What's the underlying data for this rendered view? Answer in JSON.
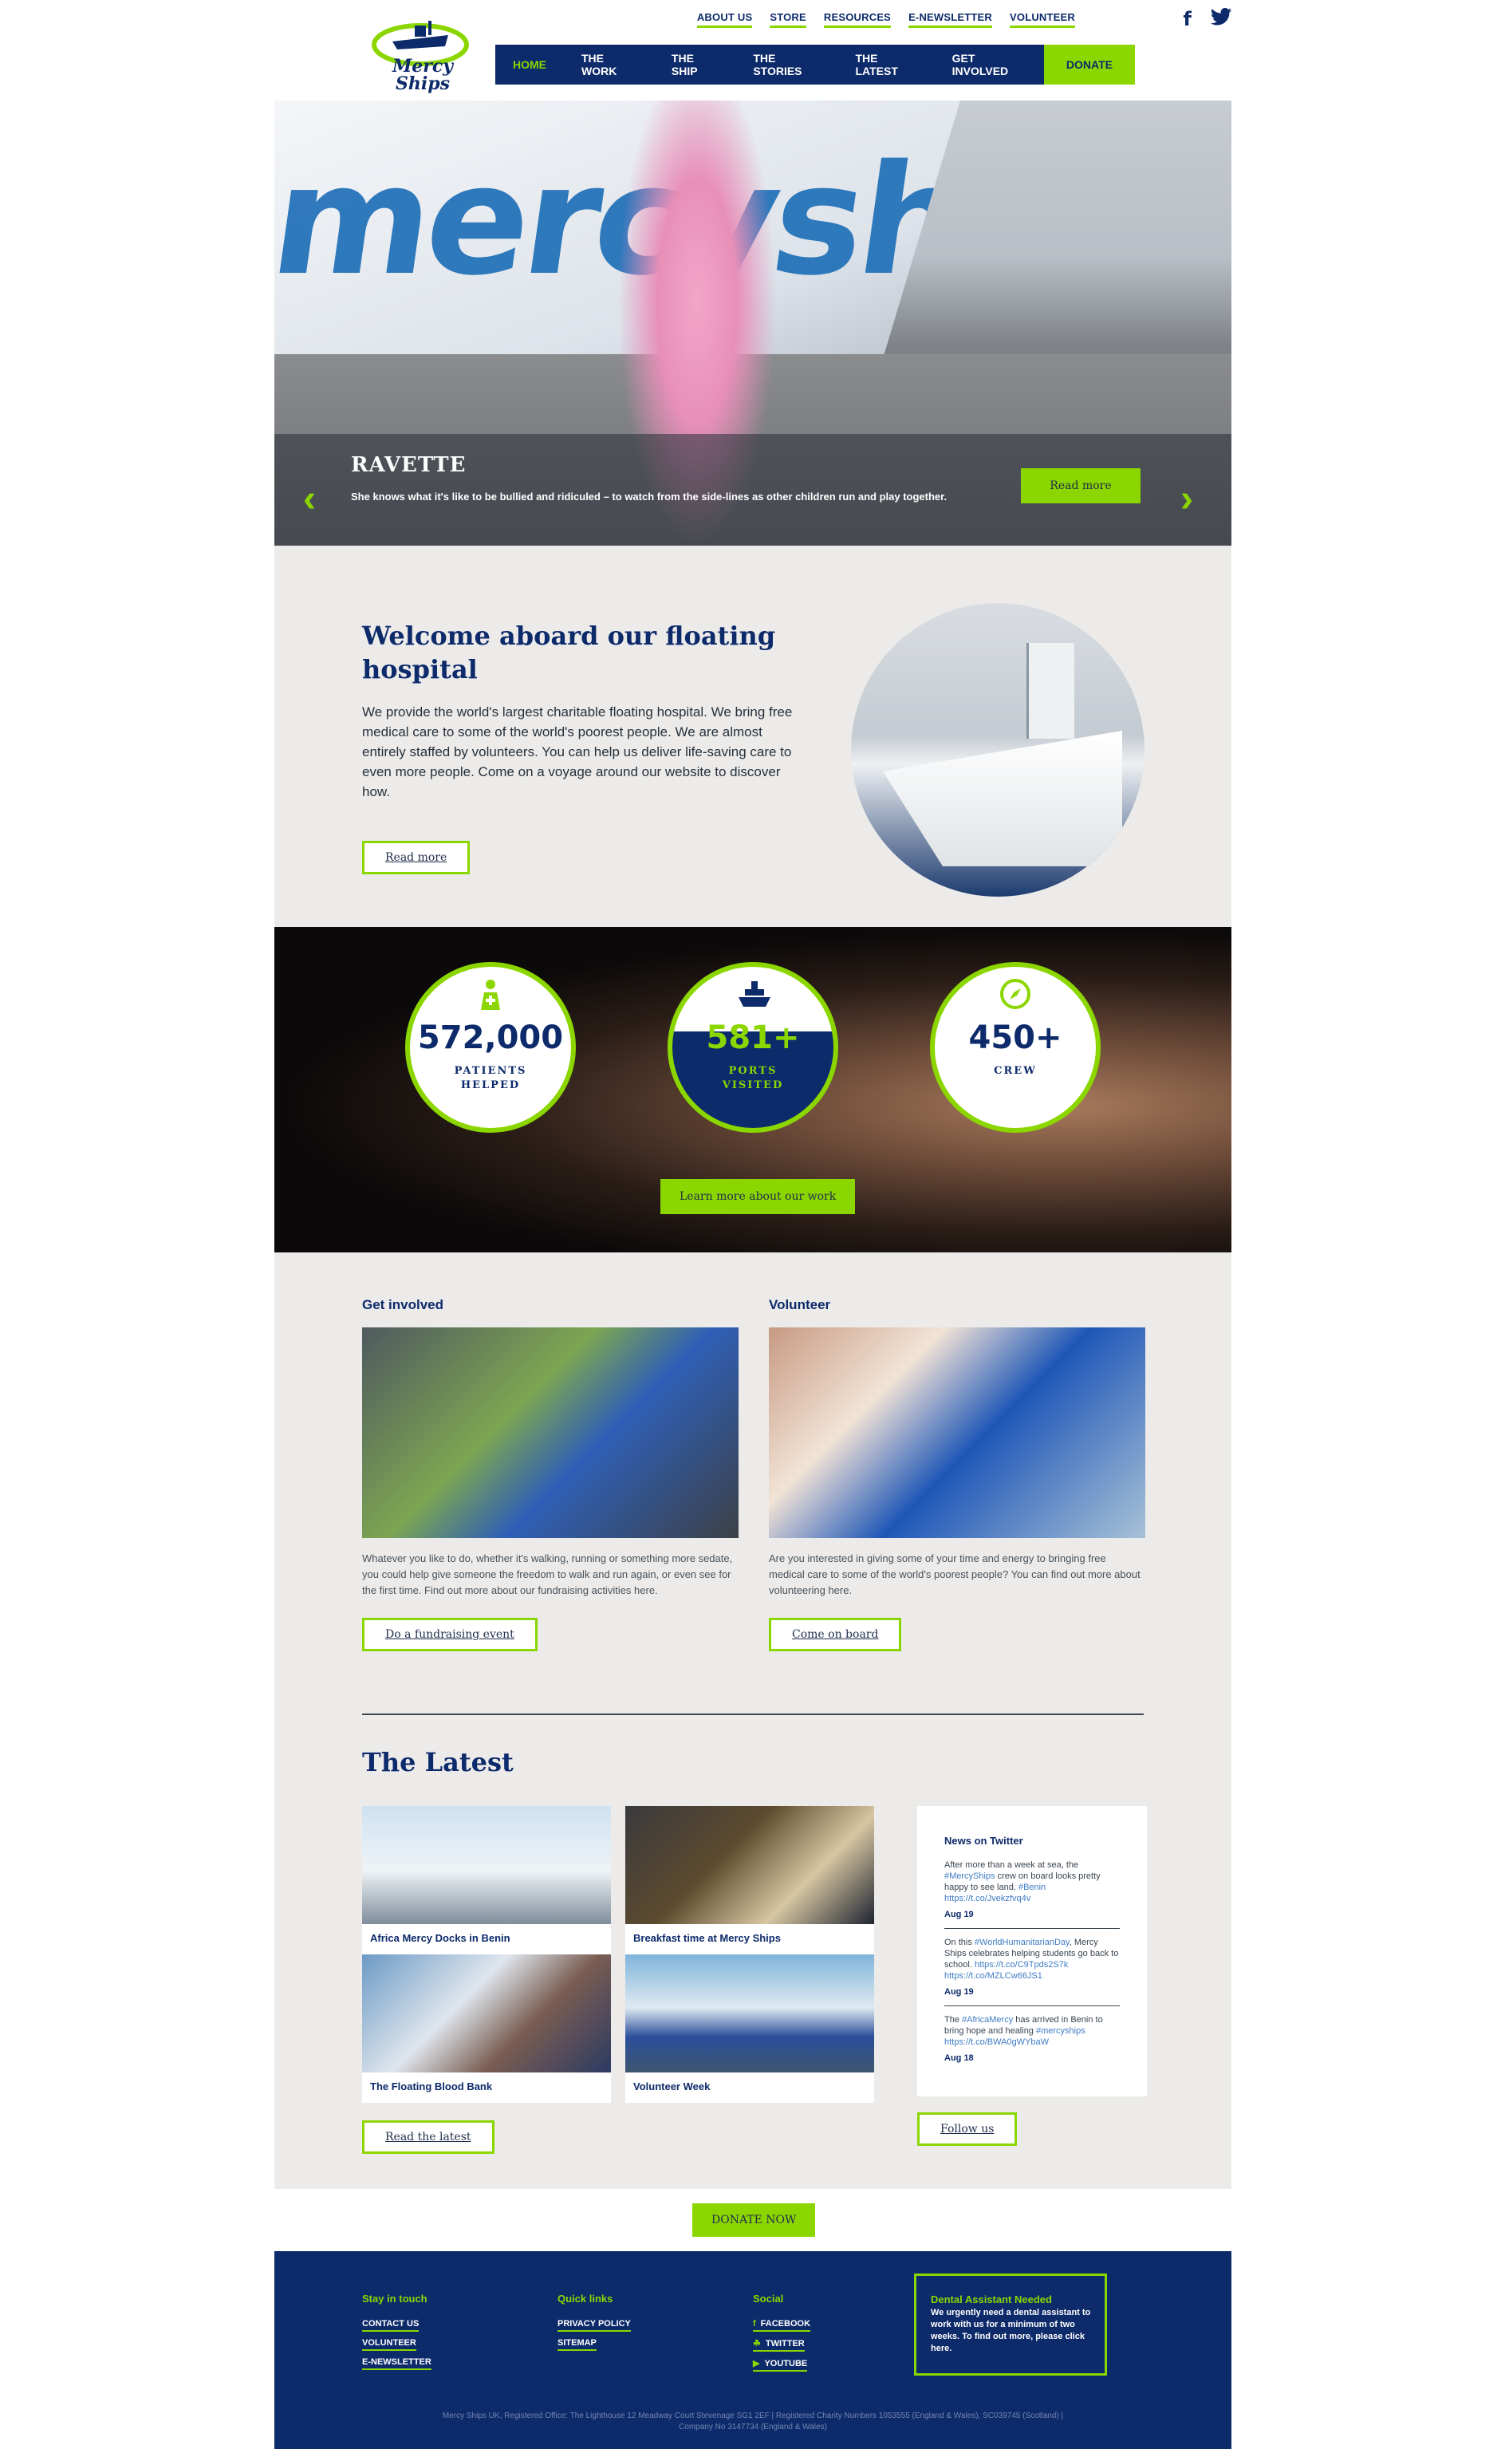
{
  "header": {
    "logo_text": "Mercy\nShips",
    "top_links": [
      "ABOUT US",
      "STORE",
      "RESOURCES",
      "E-NEWSLETTER",
      "VOLUNTEER"
    ],
    "social_icons": [
      "facebook-icon",
      "twitter-icon"
    ],
    "nav": [
      {
        "label": "HOME",
        "active": true
      },
      {
        "label": "THE WORK"
      },
      {
        "label": "THE SHIP"
      },
      {
        "label": "THE STORIES"
      },
      {
        "label": "THE LATEST"
      },
      {
        "label": "GET INVOLVED"
      },
      {
        "label": "DONATE",
        "highlight": true
      }
    ]
  },
  "hero": {
    "title": "RAVETTE",
    "description": "She knows what it's like to be bullied and ridiculed – to watch from the side-lines as other children run and play together.",
    "button": "Read more",
    "ship_text": "mercyships.org"
  },
  "welcome": {
    "title": "Welcome aboard our floating hospital",
    "body": "We provide the world's largest charitable floating hospital. We bring free medical care to some of the world's poorest people. We are almost entirely staffed by volunteers. You can help us deliver life-saving care to even more people. Come on a voyage around our website to discover how.",
    "button": "Read more"
  },
  "stats": {
    "items": [
      {
        "icon": "medic-icon",
        "value": "572,000",
        "label": "PATIENTS HELPED"
      },
      {
        "icon": "ship-icon",
        "value": "581+",
        "label": "PORTS VISITED"
      },
      {
        "icon": "compass-icon",
        "value": "450+",
        "label": "CREW"
      }
    ],
    "button": "Learn more about our work"
  },
  "involve": {
    "get_involved": {
      "title": "Get involved",
      "body": "Whatever you like to do, whether it's walking, running or something more sedate, you could help give someone the freedom to walk and run again, or even see for the first time. Find out more about our fundraising activities here.",
      "button": "Do a fundraising event"
    },
    "volunteer": {
      "title": "Volunteer",
      "body": "Are you interested in giving some of your time and energy to bringing free medical care to some of the world's poorest people? You can find out more about volunteering here.",
      "button": "Come on board"
    }
  },
  "latest": {
    "title": "The Latest",
    "news": [
      {
        "caption": "Africa Mercy Docks in Benin"
      },
      {
        "caption": "Breakfast time at Mercy Ships"
      },
      {
        "caption": "The Floating Blood Bank"
      },
      {
        "caption": "Volunteer Week"
      }
    ],
    "read_button": "Read the latest",
    "twitter": {
      "title": "News on Twitter",
      "tweets": [
        {
          "text": "After more than a week at sea, the ",
          "tag1": "#MercyShips",
          "text2": " crew on board looks pretty happy to see land. ",
          "tag2": "#Benin",
          "link": "https://t.co/Jvekzfvq4v",
          "date": "Aug 19"
        },
        {
          "text": "On this ",
          "tag1": "#WorldHumanitarianDay",
          "text2": ", Mercy Ships celebrates helping students go back to school. ",
          "tag2": "https://t.co/C9Tpds2S7k",
          "link": "https://t.co/MZLCw66JS1",
          "date": "Aug 19"
        },
        {
          "text": "The ",
          "tag1": "#AfricaMercy",
          "text2": " has arrived in Benin to bring hope and healing ",
          "tag2": "#mercyships",
          "link": "https://t.co/BWA0gWYbaW",
          "date": "Aug 18"
        }
      ],
      "follow_button": "Follow us"
    }
  },
  "donate_button": "DONATE NOW",
  "footer": {
    "stay_in_touch": {
      "title": "Stay in touch",
      "links": [
        "CONTACT US",
        "VOLUNTEER",
        "E-NEWSLETTER"
      ]
    },
    "quick_links": {
      "title": "Quick links",
      "links": [
        "PRIVACY POLICY",
        "SITEMAP"
      ]
    },
    "social": {
      "title": "Social",
      "links": [
        {
          "icon": "facebook-icon",
          "label": "FACEBOOK"
        },
        {
          "icon": "twitter-icon",
          "label": "TWITTER"
        },
        {
          "icon": "youtube-icon",
          "label": "YOUTUBE"
        }
      ]
    },
    "alert": {
      "title": "Dental Assistant Needed",
      "body": "We urgently need a dental assistant to work with us for a minimum of two weeks. To find out more, please click here."
    },
    "legal": "Mercy Ships UK, Registered Office: The Lighthouse 12 Meadway Court Stevenage SG1 2EF | Registered Charity Numbers 1053555 (England & Wales), SC039745 (Scotland) | Company No 3147734 (England & Wales)"
  },
  "colors": {
    "navy": "#0d2a6b",
    "green": "#8cd600",
    "panel": "#ecebe9"
  }
}
